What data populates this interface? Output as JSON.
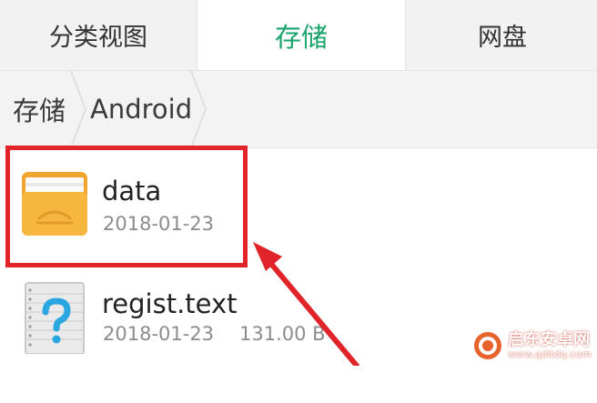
{
  "tabs": [
    {
      "label": "分类视图"
    },
    {
      "label": "存储"
    },
    {
      "label": "网盘"
    }
  ],
  "breadcrumb": [
    {
      "label": "存储"
    },
    {
      "label": "Android"
    }
  ],
  "files": [
    {
      "name": "data",
      "date": "2018-01-23",
      "icon": "folder-icon"
    },
    {
      "name": "regist.text",
      "date": "2018-01-23",
      "size": "131.00 B",
      "icon": "unknown-file-icon"
    }
  ],
  "watermark": {
    "name": "启东安卓网",
    "url": "www.qdltdq.com"
  },
  "colors": {
    "accent": "#1aa36b",
    "highlight": "#e0242a",
    "folder": "#f5b43a"
  }
}
